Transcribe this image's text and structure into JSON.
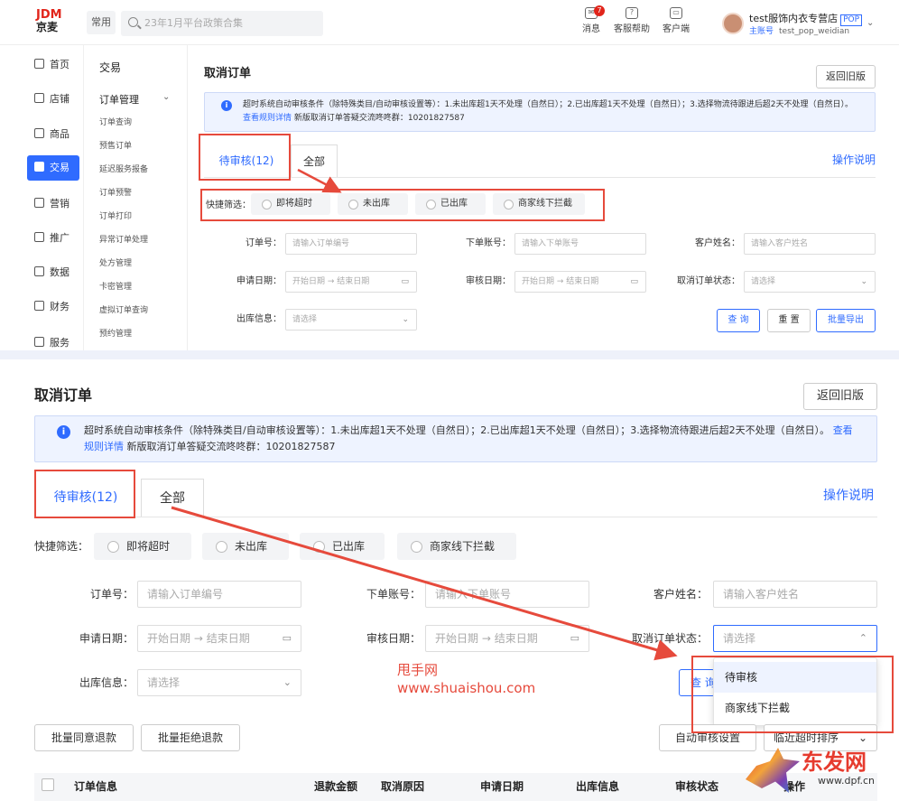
{
  "header": {
    "logo_top": "JDM",
    "logo_bottom": "京麦",
    "common": "常用",
    "search_placeholder": "23年1月平台政策合集",
    "msg_badge": "7",
    "icons": [
      {
        "label": "消息",
        "icon": "message-icon"
      },
      {
        "label": "客服帮助",
        "icon": "help-icon"
      },
      {
        "label": "客户端",
        "icon": "client-icon"
      }
    ],
    "shop_name": "test服饰内衣专营店",
    "shop_tag": "POP",
    "account_role": "主账号",
    "account_id": "test_pop_weidian"
  },
  "left_nav": [
    {
      "label": "首页",
      "icon": "home-icon"
    },
    {
      "label": "店铺",
      "icon": "store-icon"
    },
    {
      "label": "商品",
      "icon": "goods-icon"
    },
    {
      "label": "交易",
      "icon": "trade-icon",
      "active": true
    },
    {
      "label": "营销",
      "icon": "marketing-icon"
    },
    {
      "label": "推广",
      "icon": "promote-icon"
    },
    {
      "label": "数据",
      "icon": "data-icon"
    },
    {
      "label": "财务",
      "icon": "finance-icon"
    },
    {
      "label": "服务",
      "icon": "service-icon"
    }
  ],
  "sub_nav": {
    "title": "交易",
    "group": "订单管理",
    "items": [
      "订单查询",
      "预售订单",
      "延迟服务报备",
      "订单预警",
      "订单打印",
      "异常订单处理",
      "处方管理",
      "卡密管理",
      "虚拟订单查询",
      "预约管理"
    ]
  },
  "page": {
    "title": "取消订单",
    "back_btn": "返回旧版",
    "notice_text": "超时系统自动审核条件（除特殊类目/自动审核设置等）：1.未出库超1天不处理（自然日）；2.已出库超1天不处理（自然日）；3.选择物流待跟进后超2天不处理（自然日）。",
    "notice_link": "查看规则详情",
    "notice_tail": "新版取消订单答疑交流咚咚群：10201827587",
    "tab_pending": "待审核(12)",
    "tab_all": "全部",
    "help_link": "操作说明",
    "quick_filter_label": "快捷筛选：",
    "quick_filters": [
      "即将超时",
      "未出库",
      "已出库",
      "商家线下拦截"
    ],
    "fields": {
      "order_no": {
        "label": "订单号：",
        "placeholder": "请输入订单编号"
      },
      "order_account": {
        "label": "下单账号：",
        "placeholder": "请输入下单账号"
      },
      "customer_name": {
        "label": "客户姓名：",
        "placeholder": "请输入客户姓名"
      },
      "apply_date": {
        "label": "申请日期：",
        "start": "开始日期",
        "end": "结束日期"
      },
      "review_date": {
        "label": "审核日期：",
        "start": "开始日期",
        "end": "结束日期"
      },
      "cancel_status": {
        "label": "取消订单状态：",
        "placeholder": "请选择"
      },
      "outbound_info": {
        "label": "出库信息：",
        "placeholder": "请选择"
      }
    },
    "buttons": {
      "query": "查 询",
      "reset": "重 置",
      "export": "批量导出"
    }
  },
  "bottom": {
    "query_partial": "查 询",
    "dropdown_options": [
      "待审核",
      "商家线下拦截"
    ],
    "batch_agree": "批量同意退款",
    "batch_reject": "批量拒绝退款",
    "auto_review": "自动审核设置",
    "sort": "临近超时排序",
    "table_headers": [
      "订单信息",
      "退款金额",
      "取消原因",
      "申请日期",
      "出库信息",
      "审核状态",
      "操作"
    ]
  },
  "watermark": {
    "cn": "甩手网",
    "url": "www.shuaishou.com",
    "brand": "东发网",
    "brand_url": "www.dpf.cn"
  },
  "colors": {
    "accent": "#2f6bff",
    "highlight": "#e64a3c",
    "active_nav": "#2f6bff"
  }
}
